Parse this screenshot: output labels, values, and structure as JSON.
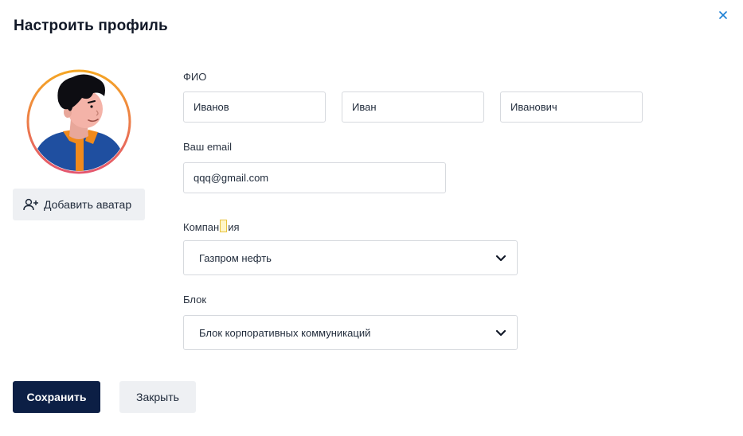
{
  "dialog": {
    "title": "Настроить профиль",
    "close_icon": "close-icon"
  },
  "avatar": {
    "add_label": "Добавить аватар",
    "add_icon": "add-user-icon",
    "ring_colors": [
      "#f5a623",
      "#e4566e"
    ]
  },
  "fio": {
    "label": "ФИО",
    "last_name": "Иванов",
    "first_name": "Иван",
    "middle_name": "Иванович"
  },
  "email": {
    "label": "Ваш email",
    "value": "qqq@gmail.com"
  },
  "company": {
    "label_before": "Компан",
    "label_after": "ия",
    "selected": "Газпром нефть",
    "icon": "chevron-down-icon"
  },
  "block": {
    "label": "Блок",
    "selected": "Блок корпоративных коммуникаций",
    "icon": "chevron-down-icon"
  },
  "actions": {
    "save_label": "Сохранить",
    "close_label": "Закрыть"
  },
  "colors": {
    "primary": "#0c1f45",
    "accent": "#1a7fd4",
    "secondary_bg": "#eef0f3"
  }
}
